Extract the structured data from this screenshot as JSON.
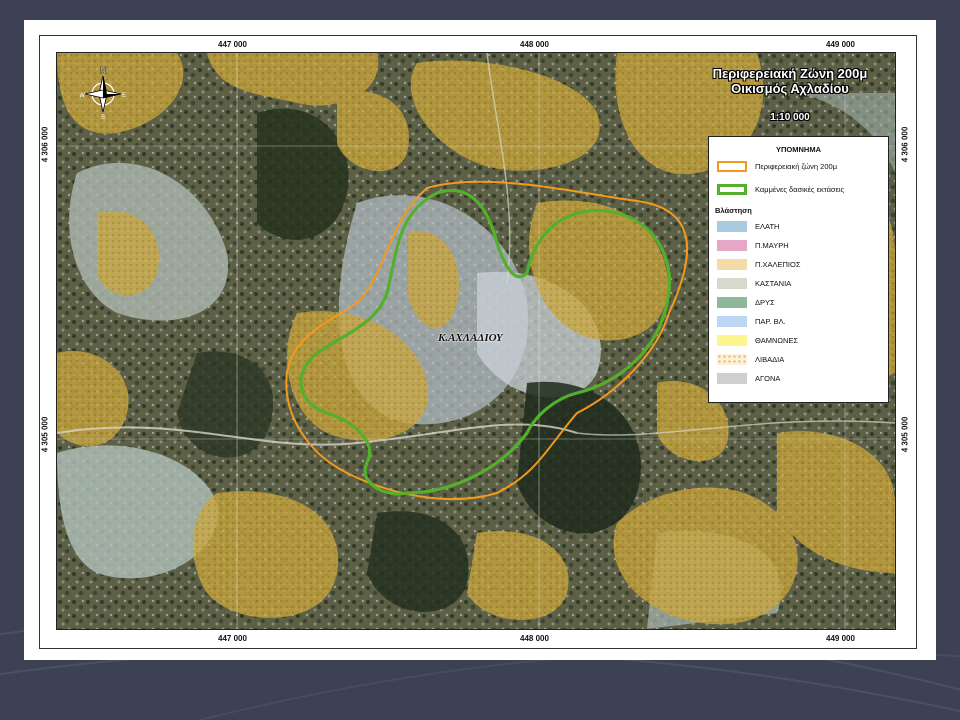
{
  "map": {
    "title_line1": "Περιφερειακή Ζώνη 200μ",
    "title_line2": "Οικισμός Αχλαδίου",
    "scale": "1:10 000",
    "village_label": "Κ.ΑΧΛΑΔΙΟΥ",
    "north_letters": {
      "n": "N",
      "w": "W",
      "e": "E",
      "s": "S"
    },
    "x_ticks": [
      "447 000",
      "448 000",
      "449 000"
    ],
    "y_ticks": [
      "4 306 000",
      "4 305 000"
    ]
  },
  "legend": {
    "title": "ΥΠΟΜΝΗΜΑ",
    "zone_label": "Περιφερειακή ζώνη 200μ",
    "burned_label": "Καμμένες δασικές εκτάσεις",
    "vegetation_heading": "Βλάστηση",
    "vegetation": [
      {
        "label": "ΕΛΑΤΗ",
        "color": "#a9cbe0"
      },
      {
        "label": "Π.ΜΑΥΡΗ",
        "color": "#e4a8c6"
      },
      {
        "label": "Π.ΧΑΛΕΠΙΟΣ",
        "color": "#f3dca5"
      },
      {
        "label": "ΚΑΣΤΑΝΙΑ",
        "color": "#d6d9cc"
      },
      {
        "label": "ΔΡΥΣ",
        "color": "#8fb89a"
      },
      {
        "label": "ΠΑΡ. ΒΛ.",
        "color": "#bcd6f4"
      },
      {
        "label": "ΘΑΜΝΩΝΕΣ",
        "color": "#fcf58d"
      },
      {
        "label": "ΛΙΒΑΔΙΑ",
        "color": "#fdf0d8"
      },
      {
        "label": "ΑΓΟΝΑ",
        "color": "#cfcfcf"
      }
    ]
  },
  "colors": {
    "zone_outline": "#f39a1e",
    "burned_outline": "#54b02c",
    "shrub_overlay": "#c8a63a"
  }
}
